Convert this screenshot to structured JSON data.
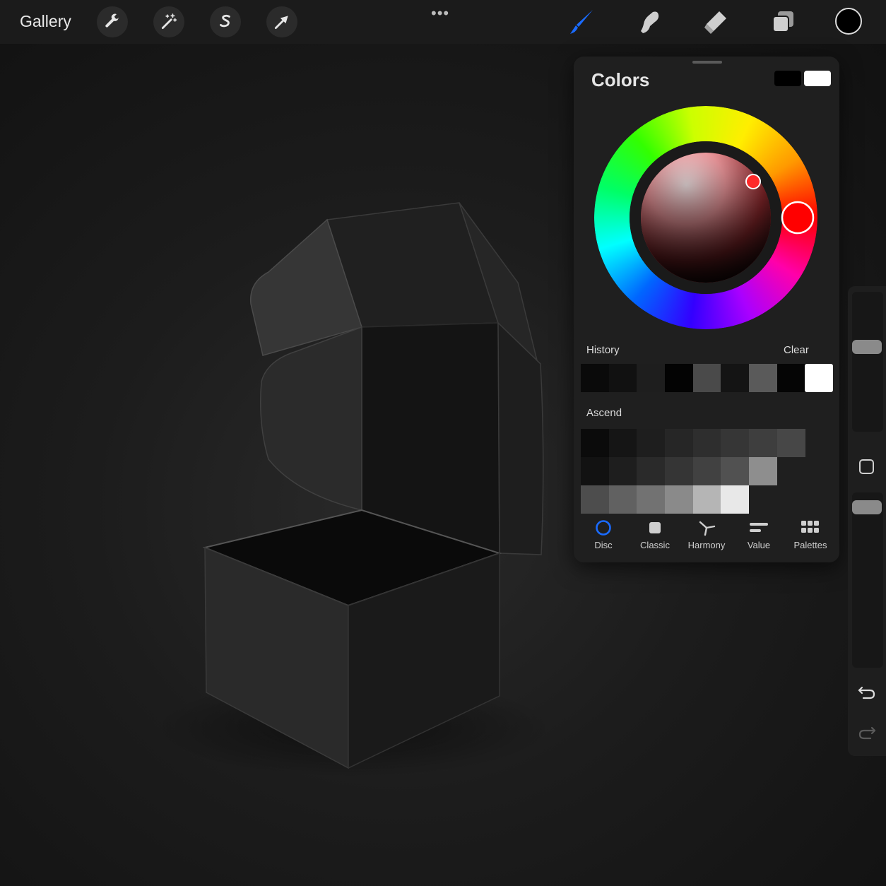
{
  "topbar": {
    "gallery_label": "Gallery",
    "left_tools": [
      "wrench-icon",
      "magic-wand-icon",
      "selection-s-icon",
      "arrow-transform-icon"
    ],
    "right_tools": [
      "brush-icon",
      "smudge-icon",
      "eraser-icon",
      "layers-icon"
    ],
    "current_color": "#000000",
    "active_tool": "brush-icon",
    "accent_color": "#1a6bff"
  },
  "colors_panel": {
    "title": "Colors",
    "primary_swatch": "#000000",
    "secondary_swatch": "#ffffff",
    "history": {
      "label": "History",
      "clear_label": "Clear",
      "swatches": [
        "#0a0a0a",
        "#111111",
        "#1e1e1e",
        "#030303",
        "#4a4a4a",
        "#141414",
        "#5a5a5a",
        "#050505",
        "#ffffff"
      ]
    },
    "palette": {
      "name": "Ascend",
      "rows": [
        [
          "#0b0b0b",
          "#151515",
          "#1e1e1e",
          "#262626",
          "#2e2e2e",
          "#363636",
          "#3e3e3e",
          "#474747"
        ],
        [
          "#121212",
          "#1e1e1e",
          "#2a2a2a",
          "#353535",
          "#414141",
          "#515151",
          "#8e8e8e"
        ],
        [
          "#4d4d4d",
          "#616161",
          "#727272",
          "#8a8a8a",
          "#b5b5b5",
          "#e8e8e8"
        ]
      ]
    },
    "tabs": [
      {
        "id": "disc",
        "label": "Disc",
        "active": true
      },
      {
        "id": "classic",
        "label": "Classic",
        "active": false
      },
      {
        "id": "harmony",
        "label": "Harmony",
        "active": false
      },
      {
        "id": "value",
        "label": "Value",
        "active": false
      },
      {
        "id": "palettes",
        "label": "Palettes",
        "active": false
      }
    ]
  },
  "sidebar": {
    "brush_size_level": 0.62,
    "opacity_level": 0.95
  }
}
